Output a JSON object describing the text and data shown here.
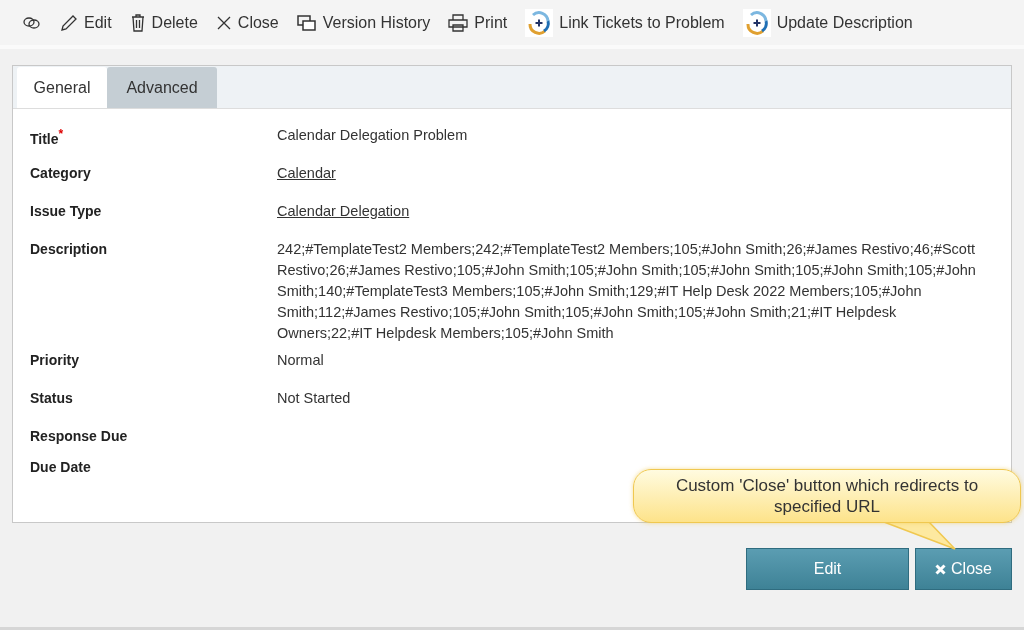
{
  "toolbar": [
    {
      "kind": "link"
    },
    {
      "kind": "edit",
      "label": "Edit"
    },
    {
      "kind": "delete",
      "label": "Delete"
    },
    {
      "kind": "close",
      "label": "Close"
    },
    {
      "kind": "history",
      "label": "Version History"
    },
    {
      "kind": "print",
      "label": "Print"
    },
    {
      "kind": "cycle",
      "label": "Link Tickets to Problem"
    },
    {
      "kind": "cycle",
      "label": "Update Description"
    }
  ],
  "tabs": [
    {
      "label": "General",
      "selected": true
    },
    {
      "label": "Advanced",
      "selected": false
    }
  ],
  "fields": [
    {
      "label": "Title",
      "required_mark": "*",
      "kind": "text",
      "value": "Calendar Delegation Problem"
    },
    {
      "label": "Category",
      "kind": "link",
      "value": "Calendar"
    },
    {
      "label": "Issue Type",
      "kind": "link",
      "value": "Calendar Delegation"
    },
    {
      "label": "Description",
      "kind": "text",
      "value": "242;#TemplateTest2 Members;242;#TemplateTest2 Members;105;#John Smith;26;#James Restivo;46;#Scott Restivo;26;#James Restivo;105;#John Smith;105;#John Smith;105;#John Smith;105;#John Smith;105;#John Smith;140;#TemplateTest3 Members;105;#John Smith;129;#IT Help Desk 2022 Members;105;#John Smith;112;#James Restivo;105;#John Smith;105;#John Smith;105;#John Smith;21;#IT Helpdesk Owners;22;#IT Helpdesk Members;105;#John Smith"
    },
    {
      "label": "Priority",
      "kind": "text",
      "value": "Normal"
    },
    {
      "label": "Status",
      "kind": "text",
      "value": "Not Started"
    },
    {
      "label": "Response Due",
      "kind": "empty"
    },
    {
      "label": "Due Date",
      "kind": "empty"
    }
  ],
  "buttons": [
    {
      "label": "Edit",
      "kind": "plain"
    },
    {
      "label": "Close",
      "kind": "close"
    }
  ],
  "callout": {
    "text": "Custom 'Close' button which redirects to specified URL"
  }
}
